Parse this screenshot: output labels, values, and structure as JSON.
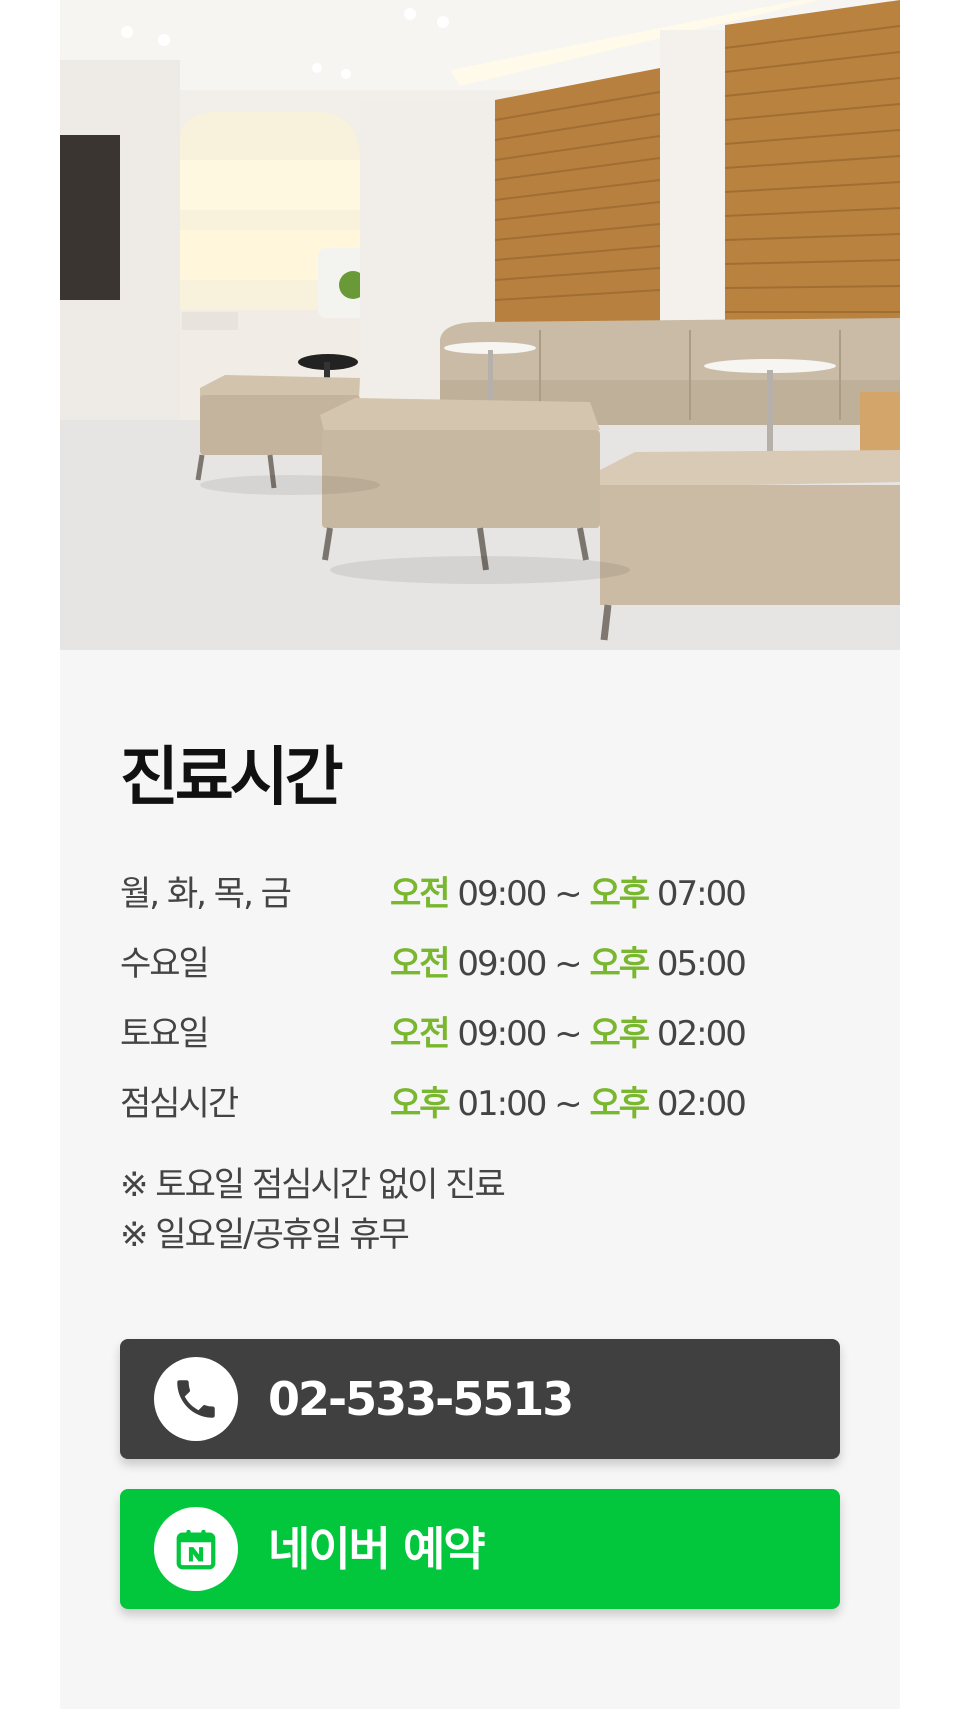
{
  "hero": {
    "alt": "병원 대기실"
  },
  "hours": {
    "title": "진료시간",
    "rows": [
      {
        "day": "월, 화, 목, 금",
        "start_ampm": "오전",
        "start": "09:00",
        "sep": "~",
        "end_ampm": "오후",
        "end": "07:00"
      },
      {
        "day": "수요일",
        "start_ampm": "오전",
        "start": "09:00",
        "sep": "~",
        "end_ampm": "오후",
        "end": "05:00"
      },
      {
        "day": "토요일",
        "start_ampm": "오전",
        "start": "09:00",
        "sep": "~",
        "end_ampm": "오후",
        "end": "02:00"
      },
      {
        "day": "점심시간",
        "start_ampm": "오후",
        "start": "01:00",
        "sep": "~",
        "end_ampm": "오후",
        "end": "02:00"
      }
    ],
    "notes": [
      "※ 토요일 점심시간 없이 진료",
      "※ 일요일/공휴일 휴무"
    ]
  },
  "buttons": {
    "phone": {
      "label": "02-533-5513",
      "icon": "phone-icon"
    },
    "naver": {
      "label": "네이버 예약",
      "icon": "naver-calendar-icon"
    }
  },
  "colors": {
    "accent_green_text": "#79b72e",
    "naver_green": "#02c73c",
    "phone_button": "#404040",
    "section_bg": "#f6f6f6"
  }
}
